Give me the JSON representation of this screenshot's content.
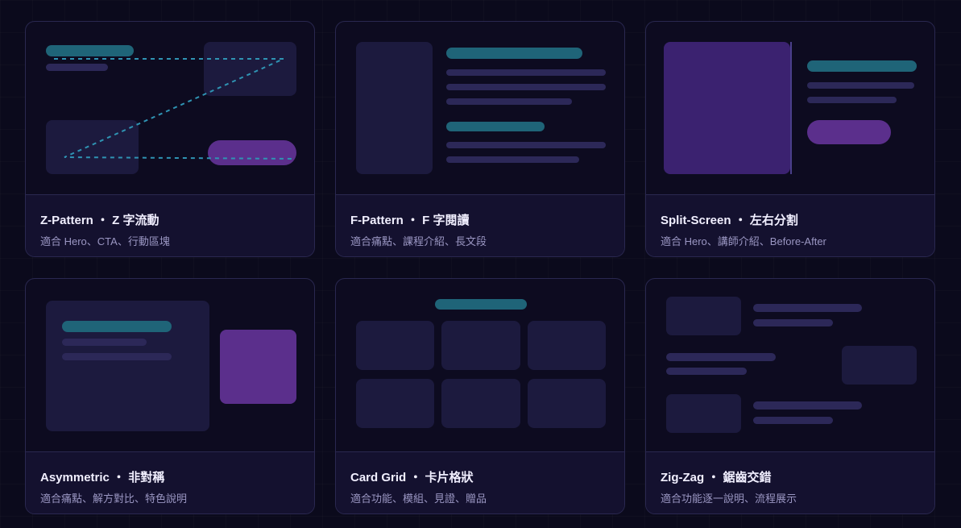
{
  "colors": {
    "page_background": "#0b0a1c",
    "card_background": "#0d0b20",
    "footer_background": "#14112f",
    "block": "#1c1a3e",
    "line": "#2c2858",
    "teal_accent": "#1f6478",
    "purple_accent": "#5b2f8c",
    "dashed_path": "#2f93b3"
  },
  "cards": [
    {
      "title": "Z-Pattern ・ Z 字流動",
      "description": "適合 Hero、CTA、行動區塊"
    },
    {
      "title": "F-Pattern ・ F 字閱讀",
      "description": "適合痛點、課程介紹、長文段"
    },
    {
      "title": "Split-Screen ・ 左右分割",
      "description": "適合 Hero、講師介紹、Before-After"
    },
    {
      "title": "Asymmetric ・ 非對稱",
      "description": "適合痛點、解方對比、特色說明"
    },
    {
      "title": "Card Grid ・ 卡片格狀",
      "description": "適合功能、模組、見證、贈品"
    },
    {
      "title": "Zig-Zag ・ 鋸齒交錯",
      "description": "適合功能逐一說明、流程展示"
    }
  ]
}
